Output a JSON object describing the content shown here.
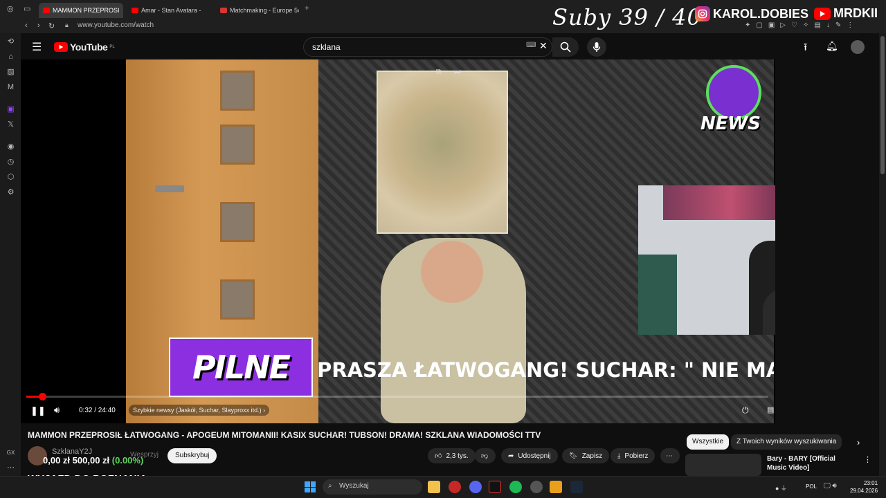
{
  "browser": {
    "tabs": [
      {
        "label": "MAMMON PRZEPROSI"
      },
      {
        "label": "Amar - Stan Avatara -"
      },
      {
        "label": "Matchmaking - Europe 5v"
      }
    ],
    "url": "www.youtube.com/watch"
  },
  "overlay": {
    "suby": "Suby 39 / 40",
    "instagram": "KAROL.DOBIES",
    "youtube": "MRDKII"
  },
  "youtube": {
    "logo": "YouTube",
    "region": "PL",
    "search_value": "szklana"
  },
  "player": {
    "time": "0:32 / 24:40",
    "progress_fraction": 0.0216,
    "chapter": "Szybkie newsy (Jaskół, Suchar, Slayproxx itd.)",
    "badge_pilne": "PILNE",
    "ticker": "PRASZA ŁATWOGANG! SUCHAR: \" NIE MA NADZIEI",
    "news_logo": "NEWS"
  },
  "video": {
    "title": "MAMMON PRZEPROSIŁ ŁATWOGANG - APOGEUM MITOMANII! KASIX SUCHAR! TUBSON! DRAMA! SZKLANA WIADOMOŚCI TTV",
    "channel": "SzklanaY2J",
    "donation": "0,00 zł",
    "goal": "500,00 zł",
    "goal_pct": "(0.00%)",
    "support_label": "Wesprzyj",
    "subscribe_label": "Subskrybuj",
    "likes": "2,3 tys.",
    "share_label": "Udostępnij",
    "save_label": "Zapisz",
    "download_label": "Pobierz",
    "banner": "WYJAZD DO POZNANIA"
  },
  "chips": [
    "Wszystkie",
    "Z Twoich wyników wyszukiwania"
  ],
  "recommendation": {
    "title": "Bary - BARY [Official Music Video]"
  },
  "taskbar": {
    "search_placeholder": "Wyszukaj",
    "lang": "POL",
    "time": "23:01",
    "date": "29.04.2026"
  },
  "colors": {
    "accent": "#ff0000",
    "pilne_bg": "#8c2fe0",
    "page_bg": "#0f0f0f"
  }
}
